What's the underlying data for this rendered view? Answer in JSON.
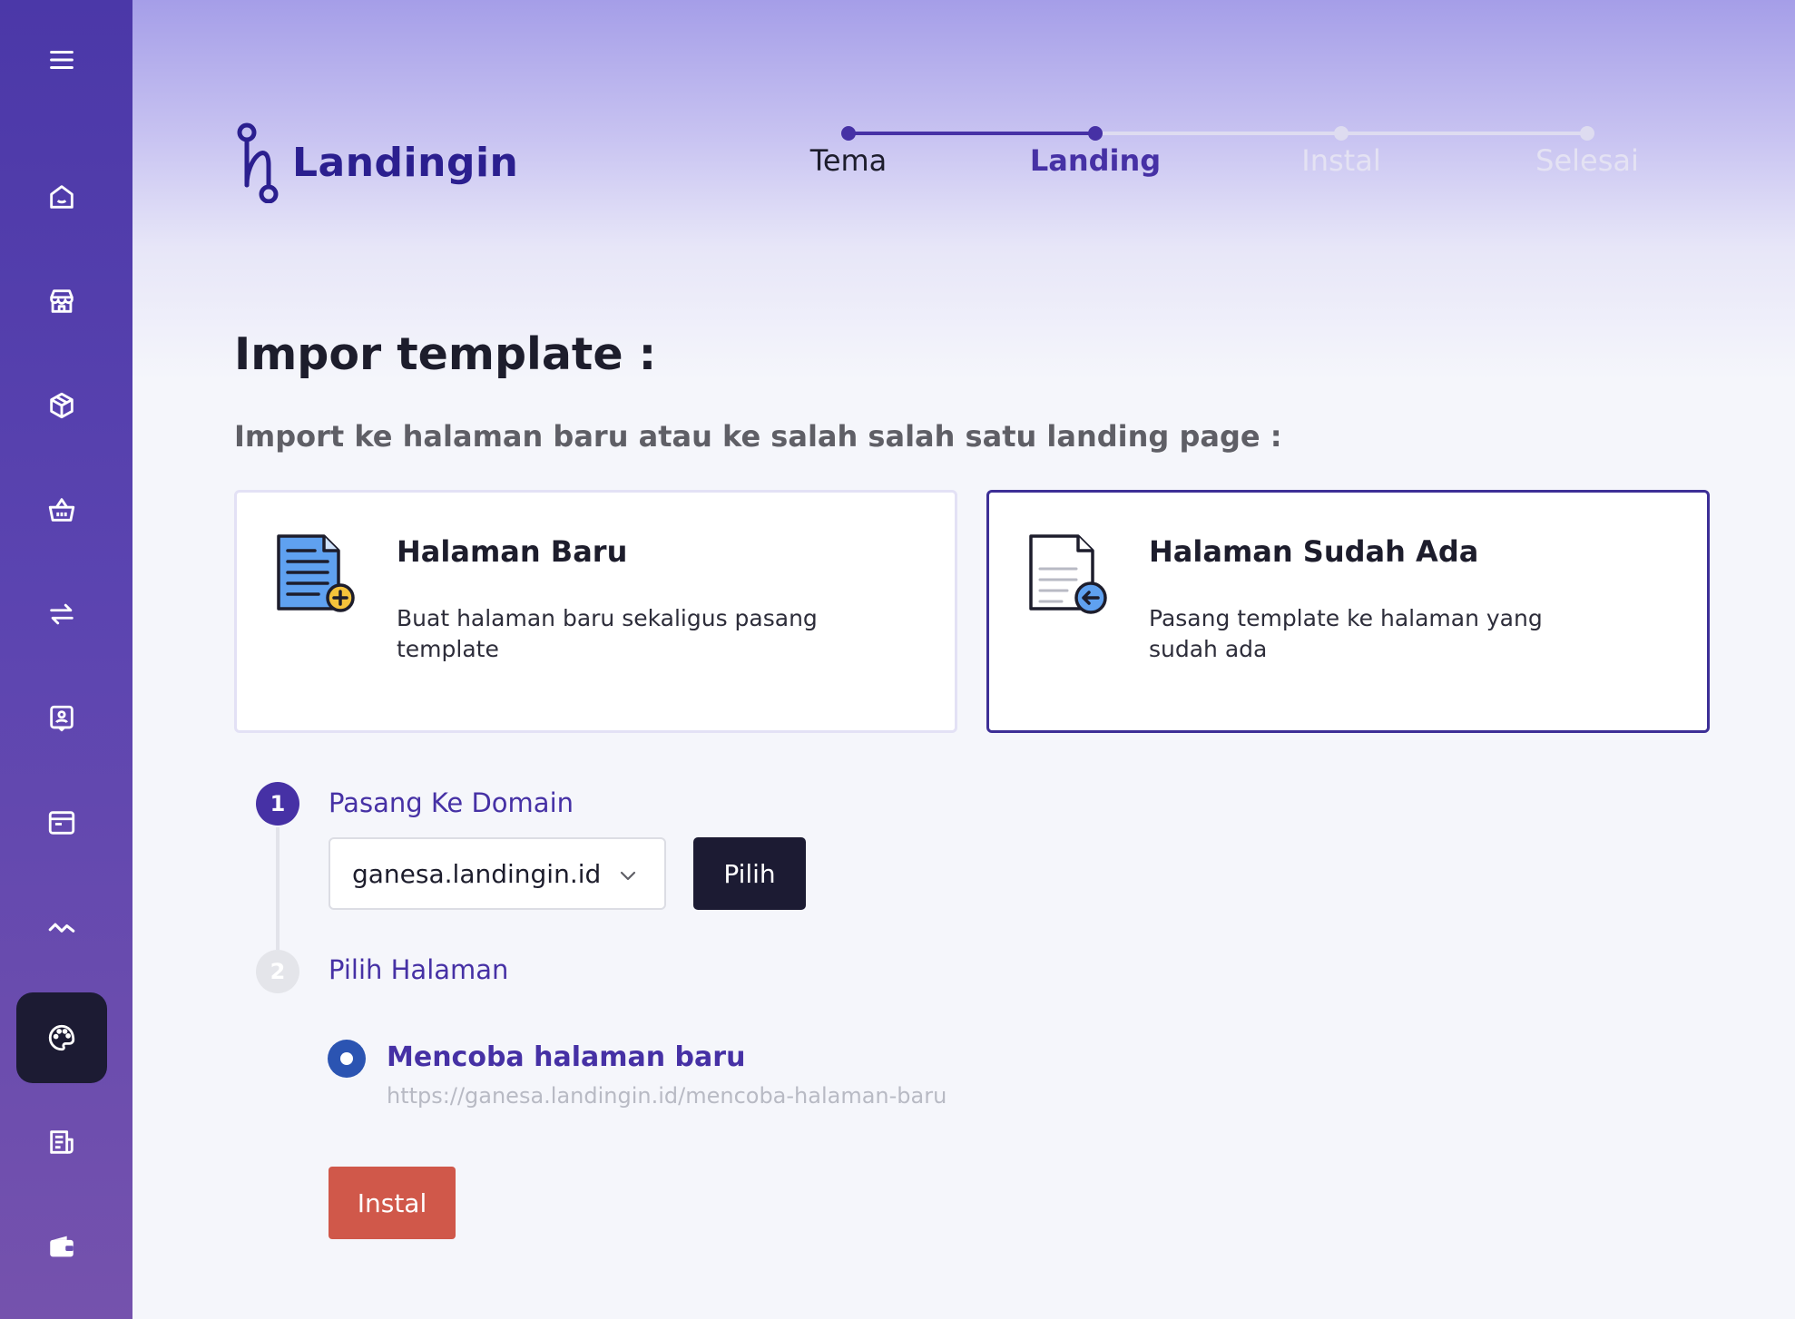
{
  "brand": {
    "name": "Landingin"
  },
  "stepper": {
    "steps": [
      {
        "label": "Tema",
        "state": "done"
      },
      {
        "label": "Landing",
        "state": "active"
      },
      {
        "label": "Instal",
        "state": "pending"
      },
      {
        "label": "Selesai",
        "state": "pending"
      }
    ]
  },
  "sidebar": {
    "items": [
      {
        "icon": "menu-icon"
      },
      {
        "icon": "home-icon"
      },
      {
        "icon": "store-icon"
      },
      {
        "icon": "box-icon"
      },
      {
        "icon": "basket-icon"
      },
      {
        "icon": "transfer-icon"
      },
      {
        "icon": "contact-icon"
      },
      {
        "icon": "browser-icon"
      },
      {
        "icon": "analytics-icon"
      },
      {
        "icon": "palette-icon",
        "active": true
      },
      {
        "icon": "report-icon"
      },
      {
        "icon": "wallet-icon"
      }
    ]
  },
  "page": {
    "title": "Impor template :",
    "subtitle": "Import ke halaman baru atau ke salah salah satu landing page :"
  },
  "cards": [
    {
      "title": "Halaman Baru",
      "desc": "Buat halaman baru sekaligus pasang template",
      "icon": "new-document-icon",
      "selected": false
    },
    {
      "title": "Halaman Sudah Ada",
      "desc": "Pasang template ke halaman yang sudah ada",
      "icon": "existing-document-icon",
      "selected": true
    }
  ],
  "steps_section": {
    "step1": {
      "number": "1",
      "label": "Pasang Ke Domain"
    },
    "step2": {
      "number": "2",
      "label": "Pilih Halaman"
    },
    "domain_select": {
      "value": "ganesa.landingin.id"
    },
    "choose_button": "Pilih",
    "page_option": {
      "title": "Mencoba halaman baru",
      "url": "https://ganesa.landingin.id/mencoba-halaman-baru"
    },
    "install_button": "Instal"
  },
  "colors": {
    "primary": "#4631a5",
    "dark": "#1c1b33",
    "danger": "#d0584a"
  }
}
